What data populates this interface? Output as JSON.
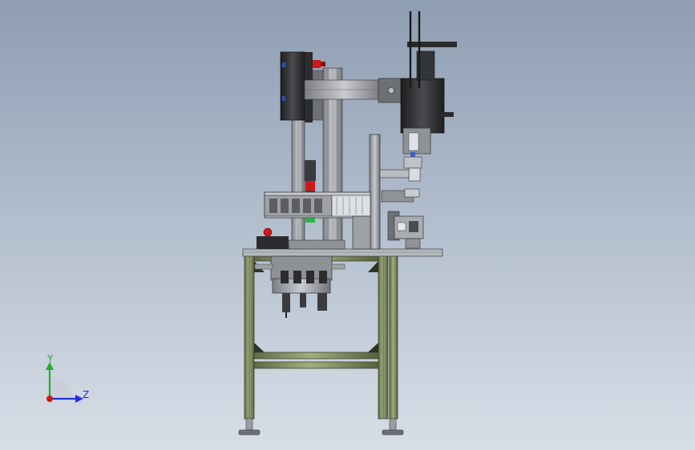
{
  "triad": {
    "y_label": "Y",
    "z_label": "Z",
    "colors": {
      "y": "#1fae2a",
      "z": "#2130d8",
      "x": "#d21414"
    }
  },
  "colors": {
    "frame_green": "#8d9a6c",
    "frame_dark": "#4e5a3b",
    "plate_gray": "#a9acb0",
    "machine_dark": "#2e2e30",
    "estop_red": "#d01818",
    "led_green": "#2fb34a"
  }
}
